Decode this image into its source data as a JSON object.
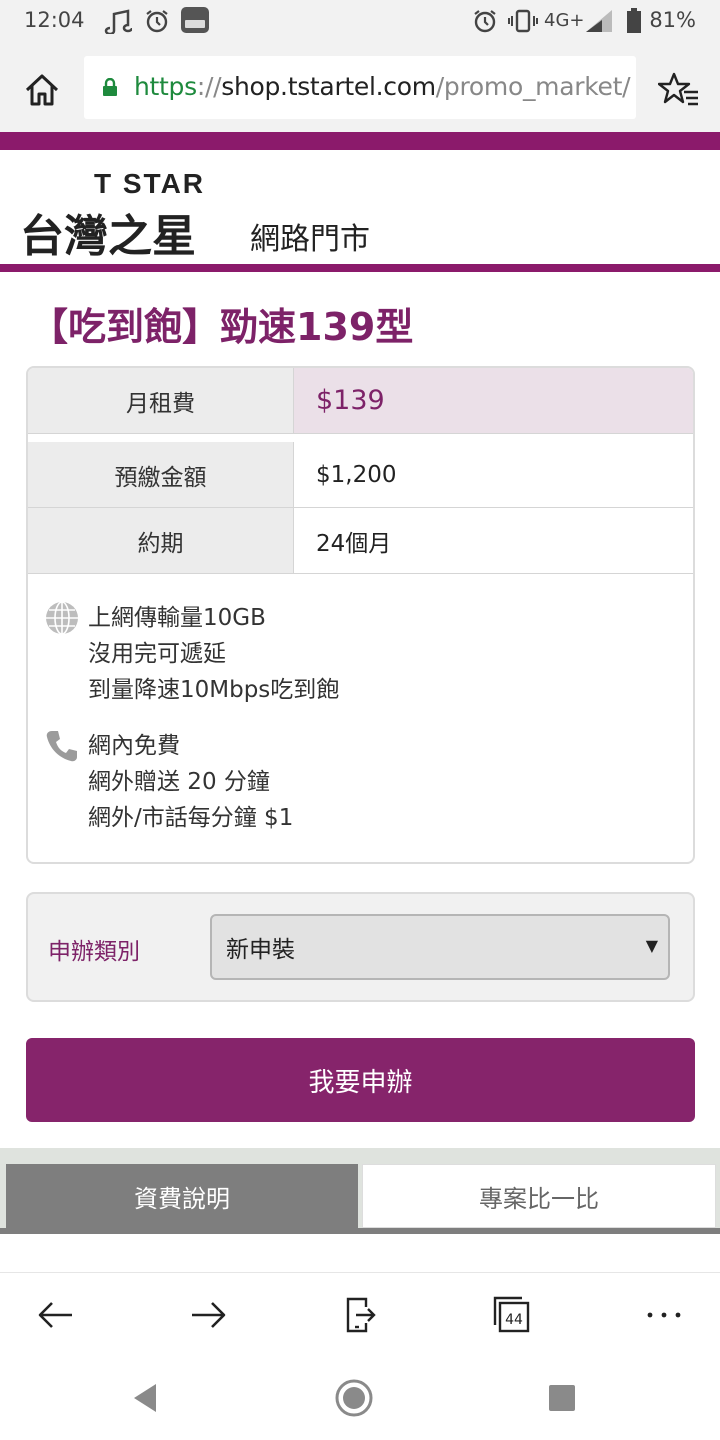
{
  "status_bar": {
    "time": "12:04",
    "network": "4G+",
    "battery": "81%"
  },
  "browser": {
    "url_scheme": "https",
    "url_sep": "://",
    "url_host": "shop.tstartel.com",
    "url_path": "/promo_market/",
    "tab_count": "44"
  },
  "header": {
    "logo_en": "T STAR",
    "logo_zh": "台灣之星",
    "store_name": "網路門市"
  },
  "plan": {
    "title": "【吃到飽】勁速139型",
    "rows": [
      {
        "label": "月租費",
        "value": "$139"
      },
      {
        "label": "預繳金額",
        "value": "$1,200"
      },
      {
        "label": "約期",
        "value": "24個月"
      }
    ],
    "data_feature": [
      "上網傳輸量10GB",
      "沒用完可遞延",
      "到量降速10Mbps吃到飽"
    ],
    "voice_feature": [
      "網內免費",
      "網外贈送 20 分鐘",
      "網外/市話每分鐘 $1"
    ]
  },
  "apply": {
    "label": "申辦類別",
    "selected": "新申裝"
  },
  "submit_label": "我要申辦",
  "tabs": [
    {
      "label": "資費說明"
    },
    {
      "label": "專案比一比"
    }
  ],
  "colors": {
    "brand": "#86246b",
    "stripe": "#8b1a6b",
    "price_highlight_bg": "#ebe0e8"
  }
}
